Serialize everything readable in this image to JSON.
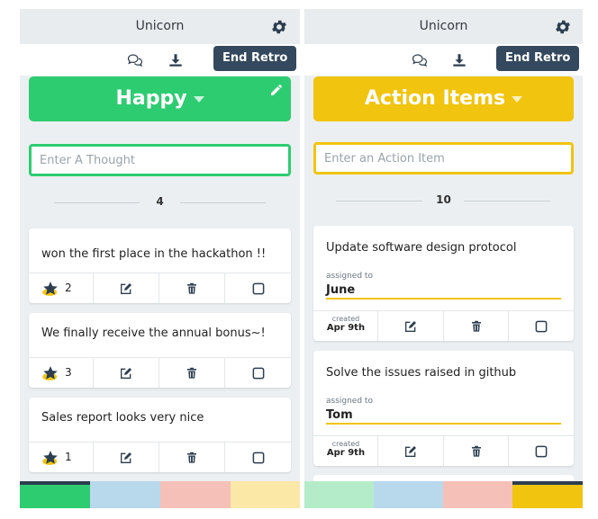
{
  "colors": {
    "happy": "#2ecc71",
    "action": "#f1c40f",
    "end_retro_bg": "#34495e"
  },
  "left": {
    "team_name": "Unicorn",
    "end_retro": "End Retro",
    "column_title": "Happy",
    "input_placeholder": "Enter A Thought",
    "count": "4",
    "cards": [
      {
        "text": "won the first place in the hackathon !!",
        "stars": "2"
      },
      {
        "text": "We finally receive the annual bonus~!",
        "stars": "3"
      },
      {
        "text": "Sales report looks very nice",
        "stars": "1"
      }
    ],
    "swatches": [
      {
        "color": "#2ecc71",
        "active": true
      },
      {
        "color": "#b8d8ec",
        "active": false
      },
      {
        "color": "#f5c0b8",
        "active": false
      },
      {
        "color": "#fbe7a6",
        "active": false
      }
    ]
  },
  "right": {
    "team_name": "Unicorn",
    "end_retro": "End Retro",
    "column_title": "Action Items",
    "input_placeholder": "Enter an Action Item",
    "count": "10",
    "cards": [
      {
        "text": "Update software design protocol",
        "assigned_label": "assigned to",
        "assignee": "June",
        "created_label": "created",
        "created_date": "Apr 9th"
      },
      {
        "text": "Solve the issues raised in github",
        "assigned_label": "assigned to",
        "assignee": "Tom",
        "created_label": "created",
        "created_date": "Apr 9th"
      }
    ],
    "swatches": [
      {
        "color": "#b4ecc9",
        "active": false
      },
      {
        "color": "#b8d8ec",
        "active": false
      },
      {
        "color": "#f5c0b8",
        "active": false
      },
      {
        "color": "#f1c40f",
        "active": true
      }
    ]
  }
}
